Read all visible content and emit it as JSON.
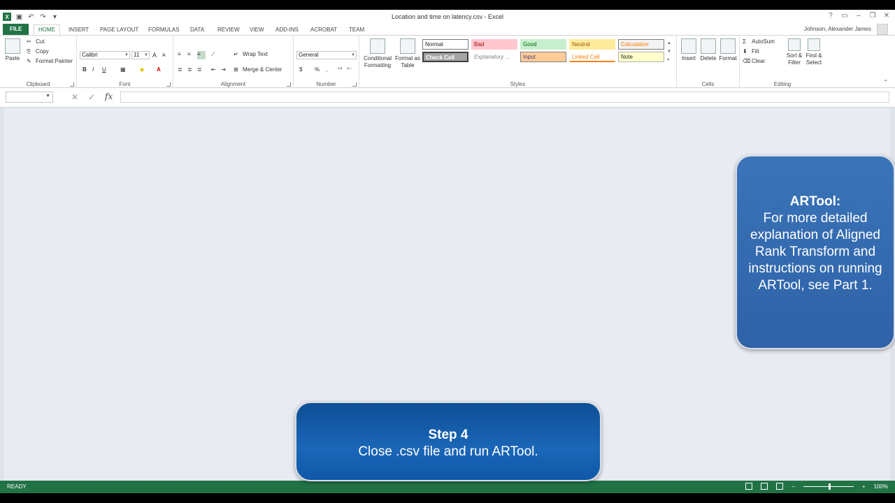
{
  "window": {
    "title": "Location and time on latency.csv - Excel",
    "user": "Johnson, Alexander James",
    "help": "?",
    "minimize": "–",
    "restore": "❐",
    "close": "✕"
  },
  "tabs": [
    "FILE",
    "HOME",
    "INSERT",
    "PAGE LAYOUT",
    "FORMULAS",
    "DATA",
    "REVIEW",
    "VIEW",
    "ADD-INS",
    "ACROBAT",
    "TEAM"
  ],
  "active_tab": "HOME",
  "ribbon": {
    "clipboard": {
      "label": "Clipboard",
      "paste": "Paste",
      "cut": "Cut",
      "copy": "Copy",
      "format_painter": "Format Painter"
    },
    "font": {
      "label": "Font",
      "family": "Calibri",
      "size": "11",
      "bold": "B",
      "italic": "I",
      "underline": "U",
      "grow": "A",
      "shrink": "A"
    },
    "alignment": {
      "label": "Alignment",
      "wrap": "Wrap Text",
      "merge": "Merge & Center"
    },
    "number": {
      "label": "Number",
      "format": "General",
      "currency": "$",
      "percent": "%",
      "comma": ","
    },
    "styles": {
      "label": "Styles",
      "conditional": "Conditional Formatting",
      "format_table": "Format as Table",
      "cells": [
        "Normal",
        "Bad",
        "Good",
        "Neutral",
        "Calculation",
        "Check Cell",
        "Explanatory ...",
        "Input",
        "Linked Cell",
        "Note"
      ]
    },
    "cells": {
      "label": "Cells",
      "insert": "Insert",
      "delete": "Delete",
      "format": "Format"
    },
    "editing": {
      "label": "Editing",
      "autosum": "AutoSum",
      "fill": "Fill",
      "clear": "Clear",
      "sort_filter": "Sort & Filter",
      "find_select": "Find & Select"
    }
  },
  "formula_bar": {
    "name_box": "",
    "cancel": "✕",
    "enter": "✓",
    "fx": "fx",
    "value": ""
  },
  "status": {
    "text": "READY",
    "zoom": "100%",
    "zoom_minus": "−",
    "zoom_plus": "+"
  },
  "callouts": {
    "artool": {
      "title": "ARTool:",
      "body": "For more detailed explanation of Aligned Rank Transform and instructions on running ARTool, see Part 1."
    },
    "step": {
      "title": "Step 4",
      "body": "Close .csv file and run ARTool."
    }
  },
  "colors": {
    "excel_green": "#217346",
    "callout_blue": "#2f62a8",
    "step_blue": "#1b66b8"
  }
}
